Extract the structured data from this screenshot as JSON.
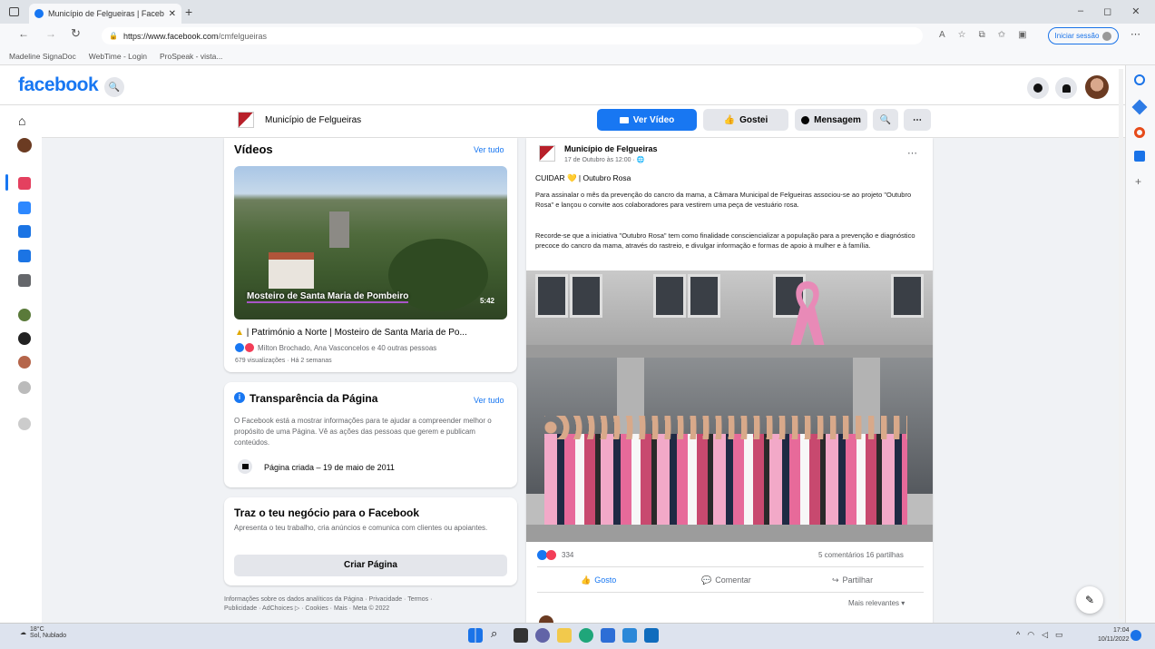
{
  "browser": {
    "tab_title": "Município de Felgueiras | Faceb",
    "url_host": "https://www.facebook.com",
    "url_path": "/cmfelgueiras",
    "signin_label": "Iniciar sessão",
    "favorites": [
      "Madeline SignaDoc",
      "WebTime - Login",
      "ProSpeak - vista..."
    ]
  },
  "facebook": {
    "logo": "facebook"
  },
  "pagebar": {
    "page_name": "Município de Felgueiras",
    "watch_video": "Ver Vídeo",
    "like": "Gostei",
    "message": "Mensagem"
  },
  "videos": {
    "title": "Vídeos",
    "see_all": "Ver tudo",
    "thumb_caption": "Mosteiro de Santa Maria de Pombeiro",
    "duration": "5:42",
    "video_title": "| Património a Norte | Mosteiro de Santa Maria de Po...",
    "reactors": "Milton Brochado, Ana Vasconcelos e 40 outras pessoas",
    "views": "679 visualizações · Há 2 semanas"
  },
  "transparency": {
    "title": "Transparência da Página",
    "see_all": "Ver tudo",
    "text": "O Facebook está a mostrar informações para te ajudar a compreender melhor o propósito de uma Página. Vê as ações das pessoas que gerem e publicam conteúdos.",
    "created": "Página criada – 19 de maio de 2011"
  },
  "business": {
    "title": "Traz o teu negócio para o Facebook",
    "text": "Apresenta o teu trabalho, cria anúncios e comunica com clientes ou apoiantes.",
    "button": "Criar Página"
  },
  "footer": {
    "line1": "Informações sobre os dados analíticos da Página · Privacidade · Termos ·",
    "line2": "Publicidade · AdChoices ▷ · Cookies · Mais · Meta © 2022"
  },
  "post": {
    "author": "Município de Felgueiras",
    "time": "17 de Outubro às 12:00 ·",
    "headline": "CUIDAR 💛 | Outubro Rosa",
    "para1": "Para assinalar o mês da prevenção do cancro da mama, a Câmara Municipal de Felgueiras associou-se ao projeto \"Outubro Rosa\" e lançou o convite aos colaboradores para vestirem uma peça de vestuário rosa.",
    "para2": "Recorde-se que a iniciativa \"Outubro Rosa\" tem como finalidade consciencializar a população para a prevenção e diagnóstico precoce do cancro da mama, através do rastreio, e divulgar informação e formas de apoio à mulher e à família.",
    "reaction_count": "334",
    "comments_shares": "5 comentários  16 partilhas",
    "like": "Gosto",
    "comment": "Comentar",
    "share": "Partilhar",
    "sort": "Mais relevantes ▾"
  },
  "taskbar": {
    "weather_temp": "18°C",
    "weather_desc": "Sol, Nublado",
    "time": "17:04",
    "date": "10/11/2022"
  },
  "colors": {
    "fb_blue": "#1877f2",
    "pink": "#e88ab7"
  }
}
